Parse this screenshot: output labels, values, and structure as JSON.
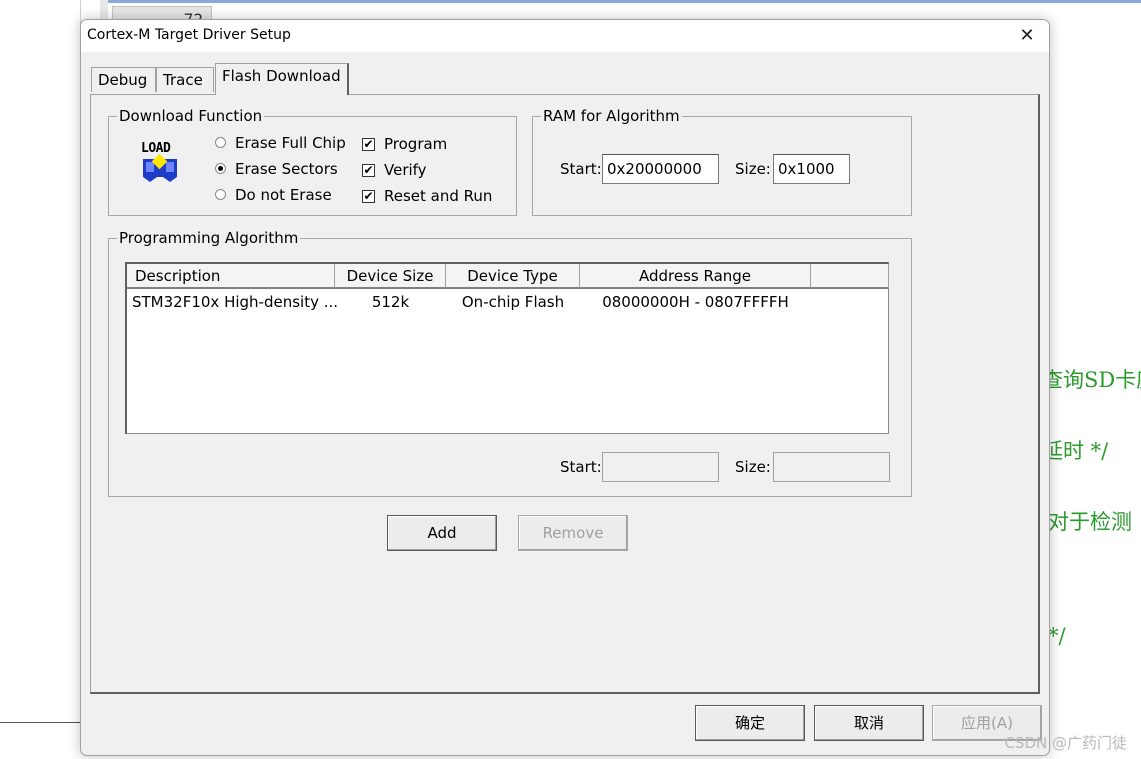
{
  "background": {
    "line_number": "72",
    "comments": [
      "查询SD卡座",
      "延时 */",
      "对于检测",
      "*/"
    ],
    "watermark": "CSDN @广药门徒"
  },
  "dialog": {
    "title": "Cortex-M Target Driver Setup",
    "tabs": [
      "Debug",
      "Trace",
      "Flash Download"
    ],
    "active_tab": "Flash Download",
    "download_function": {
      "label": "Download Function",
      "icon_text": "LOAD",
      "radios": [
        {
          "label": "Erase Full Chip",
          "checked": false
        },
        {
          "label": "Erase Sectors",
          "checked": true
        },
        {
          "label": "Do not Erase",
          "checked": false
        }
      ],
      "checks": [
        {
          "label": "Program",
          "checked": true
        },
        {
          "label": "Verify",
          "checked": true
        },
        {
          "label": "Reset and Run",
          "checked": true
        }
      ]
    },
    "ram_for_algorithm": {
      "label": "RAM for Algorithm",
      "start_label": "Start:",
      "start_value": "0x20000000",
      "size_label": "Size:",
      "size_value": "0x1000"
    },
    "programming_algorithm": {
      "label": "Programming Algorithm",
      "columns": [
        "Description",
        "Device Size",
        "Device Type",
        "Address Range"
      ],
      "rows": [
        {
          "description": "STM32F10x High-density ...",
          "device_size": "512k",
          "device_type": "On-chip Flash",
          "address_range": "08000000H - 0807FFFFH"
        }
      ],
      "start_label": "Start:",
      "start_value": "",
      "size_label": "Size:",
      "size_value": ""
    },
    "add_label": "Add",
    "remove_label": "Remove",
    "ok_label": "确定",
    "cancel_label": "取消",
    "apply_label": "应用(A)",
    "check_mark": "✔",
    "close_glyph": "✕"
  }
}
